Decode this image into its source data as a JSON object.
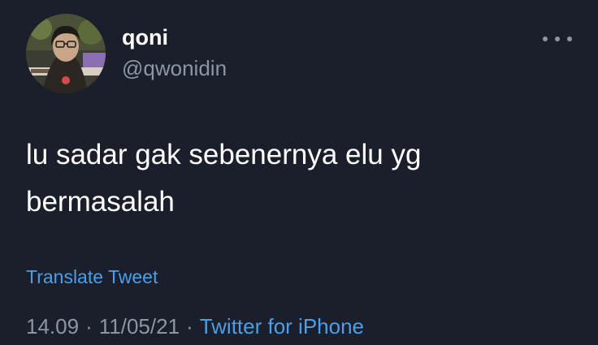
{
  "tweet": {
    "author": {
      "display_name": "qoni",
      "handle": "@qwonidin",
      "avatar_icon": "profile-photo"
    },
    "text_line_1": "lu sadar gak sebenernya elu yg",
    "text_line_2": "bermasalah",
    "translate_label": "Translate Tweet",
    "time": "14.09",
    "date": "11/05/21",
    "separator": "·",
    "source": "Twitter for iPhone",
    "more_icon": "more-horizontal-icon"
  },
  "colors": {
    "background": "#1a1f2b",
    "primary_text": "#ffffff",
    "secondary_text": "#8b97a5",
    "link": "#4a9fe8"
  }
}
